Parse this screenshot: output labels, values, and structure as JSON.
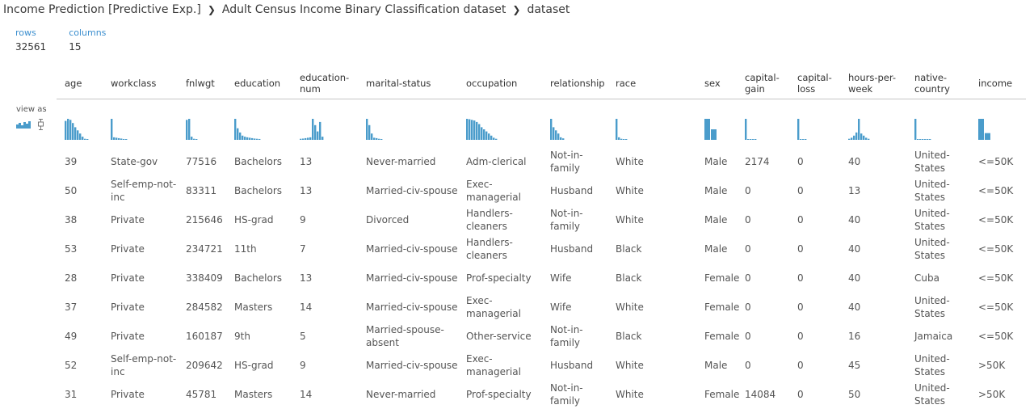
{
  "breadcrumb": [
    "Income Prediction [Predictive Exp.]",
    "Adult Census Income Binary Classification dataset",
    "dataset"
  ],
  "stats": {
    "rows_label": "rows",
    "rows_value": "32561",
    "columns_label": "columns",
    "columns_value": "15"
  },
  "view_as": {
    "label": "view as",
    "icons": [
      "histogram-icon",
      "boxplot-icon"
    ]
  },
  "columns": [
    {
      "key": "age",
      "label": "age",
      "hist": [
        0.9,
        1,
        0.95,
        0.8,
        0.6,
        0.45,
        0.3,
        0.15,
        0.05,
        0.02
      ]
    },
    {
      "key": "workclass",
      "label": "workclass",
      "hist": [
        1,
        0.12,
        0.1,
        0.08,
        0.06,
        0.04,
        0.02
      ]
    },
    {
      "key": "fnlwgt",
      "label": "fnlwgt",
      "hist": [
        0.95,
        1,
        0.15,
        0.05,
        0.02
      ]
    },
    {
      "key": "education",
      "label": "education",
      "hist": [
        1,
        0.55,
        0.35,
        0.2,
        0.15,
        0.12,
        0.1,
        0.08,
        0.06,
        0.05,
        0.04
      ]
    },
    {
      "key": "education_num",
      "label": "education-num",
      "hist": [
        0.05,
        0.06,
        0.08,
        0.1,
        0.12,
        1,
        0.7,
        0.4,
        0.85,
        0.15
      ]
    },
    {
      "key": "marital_status",
      "label": "marital-status",
      "hist": [
        1,
        0.7,
        0.3,
        0.1,
        0.08,
        0.05,
        0.03
      ]
    },
    {
      "key": "occupation",
      "label": "occupation",
      "hist": [
        1,
        0.98,
        0.95,
        0.92,
        0.85,
        0.75,
        0.6,
        0.5,
        0.4,
        0.3,
        0.2,
        0.1,
        0.05
      ]
    },
    {
      "key": "relationship",
      "label": "relationship",
      "hist": [
        1,
        0.6,
        0.45,
        0.3,
        0.12,
        0.07
      ]
    },
    {
      "key": "race",
      "label": "race",
      "hist": [
        1,
        0.12,
        0.05,
        0.03,
        0.02
      ]
    },
    {
      "key": "sex",
      "label": "sex",
      "hist": [
        1,
        0.5
      ]
    },
    {
      "key": "capital_gain",
      "label": "capital-gain",
      "hist": [
        1,
        0.03,
        0.02,
        0.01,
        0.01
      ]
    },
    {
      "key": "capital_loss",
      "label": "capital-loss",
      "hist": [
        1,
        0.03,
        0.02,
        0.01
      ]
    },
    {
      "key": "hours_per_week",
      "label": "hours-per-week",
      "hist": [
        0.05,
        0.1,
        0.2,
        0.35,
        1,
        0.3,
        0.2,
        0.1,
        0.05
      ]
    },
    {
      "key": "native_country",
      "label": "native-country",
      "hist": [
        1,
        0.03,
        0.02,
        0.02,
        0.01,
        0.01,
        0.01
      ]
    },
    {
      "key": "income",
      "label": "income",
      "hist": [
        1,
        0.32
      ]
    }
  ],
  "rows": [
    [
      "39",
      "State-gov",
      "77516",
      "Bachelors",
      "13",
      "Never-married",
      "Adm-clerical",
      "Not-in-family",
      "White",
      "Male",
      "2174",
      "0",
      "40",
      "United-States",
      "<=50K"
    ],
    [
      "50",
      "Self-emp-not-inc",
      "83311",
      "Bachelors",
      "13",
      "Married-civ-spouse",
      "Exec-managerial",
      "Husband",
      "White",
      "Male",
      "0",
      "0",
      "13",
      "United-States",
      "<=50K"
    ],
    [
      "38",
      "Private",
      "215646",
      "HS-grad",
      "9",
      "Divorced",
      "Handlers-cleaners",
      "Not-in-family",
      "White",
      "Male",
      "0",
      "0",
      "40",
      "United-States",
      "<=50K"
    ],
    [
      "53",
      "Private",
      "234721",
      "11th",
      "7",
      "Married-civ-spouse",
      "Handlers-cleaners",
      "Husband",
      "Black",
      "Male",
      "0",
      "0",
      "40",
      "United-States",
      "<=50K"
    ],
    [
      "28",
      "Private",
      "338409",
      "Bachelors",
      "13",
      "Married-civ-spouse",
      "Prof-specialty",
      "Wife",
      "Black",
      "Female",
      "0",
      "0",
      "40",
      "Cuba",
      "<=50K"
    ],
    [
      "37",
      "Private",
      "284582",
      "Masters",
      "14",
      "Married-civ-spouse",
      "Exec-managerial",
      "Wife",
      "White",
      "Female",
      "0",
      "0",
      "40",
      "United-States",
      "<=50K"
    ],
    [
      "49",
      "Private",
      "160187",
      "9th",
      "5",
      "Married-spouse-absent",
      "Other-service",
      "Not-in-family",
      "Black",
      "Female",
      "0",
      "0",
      "16",
      "Jamaica",
      "<=50K"
    ],
    [
      "52",
      "Self-emp-not-inc",
      "209642",
      "HS-grad",
      "9",
      "Married-civ-spouse",
      "Exec-managerial",
      "Husband",
      "White",
      "Male",
      "0",
      "0",
      "45",
      "United-States",
      ">50K"
    ],
    [
      "31",
      "Private",
      "45781",
      "Masters",
      "14",
      "Never-married",
      "Prof-specialty",
      "Not-in-family",
      "White",
      "Female",
      "14084",
      "0",
      "50",
      "United-States",
      ">50K"
    ]
  ],
  "colors": {
    "accent": "#3c8fcf",
    "hist": "#4a9ccb"
  }
}
